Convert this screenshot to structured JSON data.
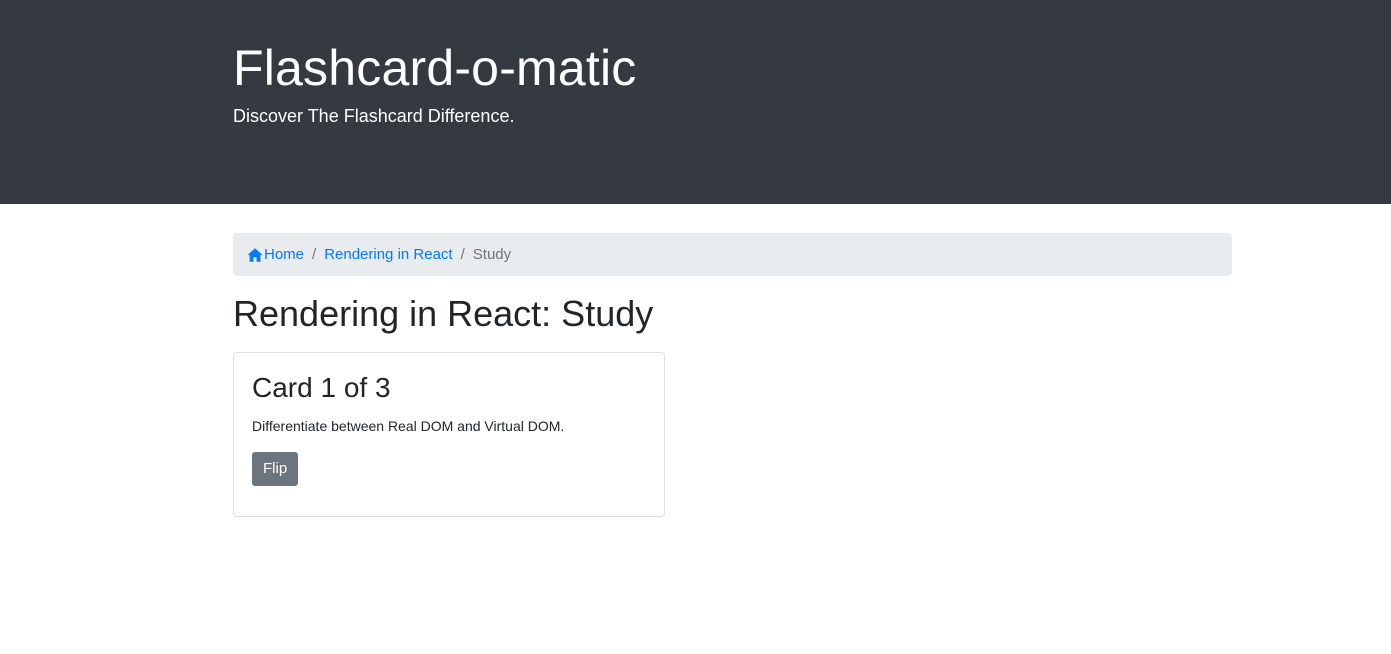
{
  "header": {
    "title": "Flashcard-o-matic",
    "subtitle": "Discover The Flashcard Difference.",
    "background_color": "#343a40"
  },
  "breadcrumb": {
    "items": [
      {
        "label": "Home",
        "icon": "home-icon",
        "link": true
      },
      {
        "label": "Rendering in React",
        "link": true
      },
      {
        "label": "Study",
        "link": false
      }
    ],
    "separator": "/",
    "link_color": "#007bff"
  },
  "page": {
    "title": "Rendering in React: Study"
  },
  "card": {
    "title": "Card 1 of 3",
    "text": "Differentiate between Real DOM and Virtual DOM.",
    "flip_label": "Flip",
    "button_color": "#6c757d"
  }
}
